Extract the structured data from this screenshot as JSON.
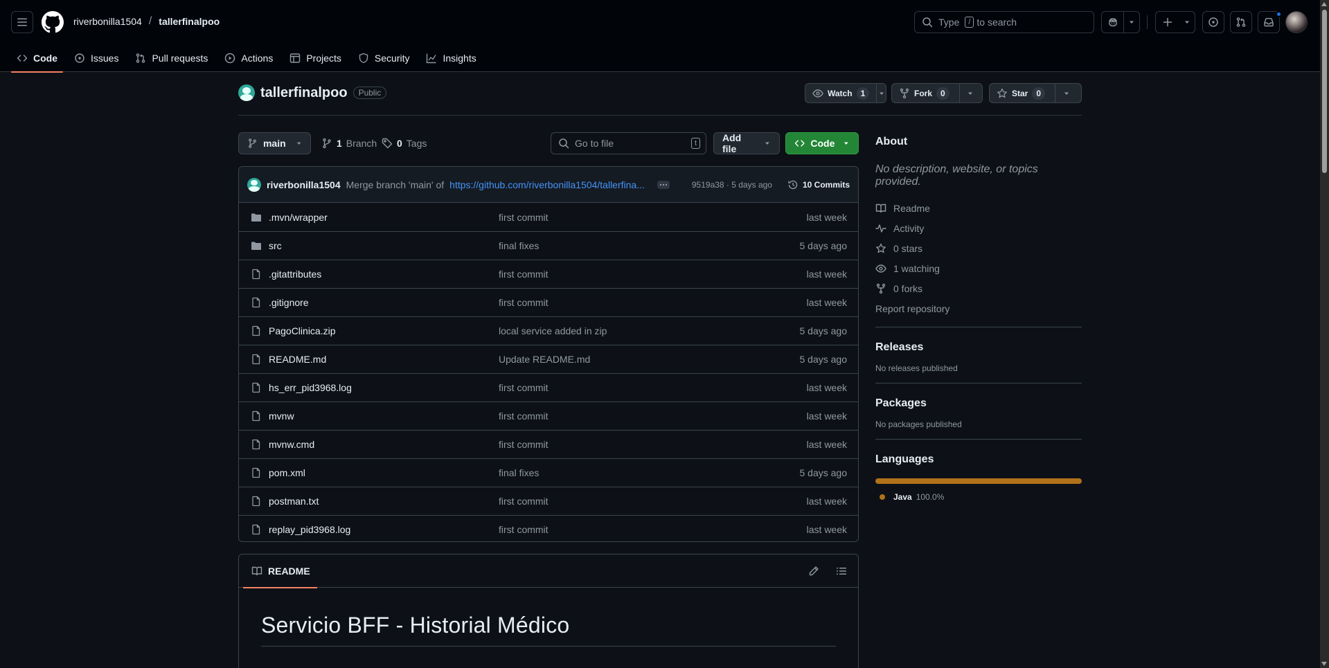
{
  "header": {
    "owner": "riverbonilla1504",
    "separator": "/",
    "repo": "tallerfinalpoo",
    "search_prefix": "Type",
    "search_key": "/",
    "search_suffix": "to search"
  },
  "repo_nav": {
    "tabs": [
      {
        "label": "Code",
        "icon": "code-icon",
        "active": true
      },
      {
        "label": "Issues",
        "icon": "issue-icon"
      },
      {
        "label": "Pull requests",
        "icon": "pull-request-icon"
      },
      {
        "label": "Actions",
        "icon": "play-icon"
      },
      {
        "label": "Projects",
        "icon": "table-icon"
      },
      {
        "label": "Security",
        "icon": "shield-icon"
      },
      {
        "label": "Insights",
        "icon": "graph-icon"
      }
    ]
  },
  "repo": {
    "name": "tallerfinalpoo",
    "visibility": "Public",
    "watch": {
      "label": "Watch",
      "count": "1"
    },
    "fork": {
      "label": "Fork",
      "count": "0"
    },
    "star": {
      "label": "Star",
      "count": "0"
    }
  },
  "branch_bar": {
    "branch": "main",
    "branches_count": "1",
    "branches_label": "Branch",
    "tags_count": "0",
    "tags_label": "Tags",
    "goto_placeholder": "Go to file",
    "goto_key": "t",
    "add_file": "Add file",
    "code_button": "Code"
  },
  "latest_commit": {
    "author": "riverbonilla1504",
    "message": "Merge branch 'main' of",
    "link": "https://github.com/riverbonilla1504/tallerfina...",
    "hash_time": "9519a38 · 5 days ago",
    "commits_count": "10 Commits"
  },
  "files": [
    {
      "name": ".mvn/wrapper",
      "type": "folder",
      "message": "first commit",
      "date": "last week"
    },
    {
      "name": "src",
      "type": "folder",
      "message": "final fixes",
      "date": "5 days ago"
    },
    {
      "name": ".gitattributes",
      "type": "file",
      "message": "first commit",
      "date": "last week"
    },
    {
      "name": ".gitignore",
      "type": "file",
      "message": "first commit",
      "date": "last week"
    },
    {
      "name": "PagoClinica.zip",
      "type": "file",
      "message": "local service added in zip",
      "date": "5 days ago"
    },
    {
      "name": "README.md",
      "type": "file",
      "message": "Update README.md",
      "date": "5 days ago"
    },
    {
      "name": "hs_err_pid3968.log",
      "type": "file",
      "message": "first commit",
      "date": "last week"
    },
    {
      "name": "mvnw",
      "type": "file",
      "message": "first commit",
      "date": "last week"
    },
    {
      "name": "mvnw.cmd",
      "type": "file",
      "message": "first commit",
      "date": "last week"
    },
    {
      "name": "pom.xml",
      "type": "file",
      "message": "final fixes",
      "date": "5 days ago"
    },
    {
      "name": "postman.txt",
      "type": "file",
      "message": "first commit",
      "date": "last week"
    },
    {
      "name": "replay_pid3968.log",
      "type": "file",
      "message": "first commit",
      "date": "last week"
    }
  ],
  "readme": {
    "tab": "README",
    "heading": "Servicio BFF - Historial Médico"
  },
  "about": {
    "title": "About",
    "description": "No description, website, or topics provided.",
    "links": [
      {
        "label": "Readme",
        "icon": "book-icon"
      },
      {
        "label": "Activity",
        "icon": "pulse-icon"
      },
      {
        "label": "0 stars",
        "icon": "star-icon"
      },
      {
        "label": "1 watching",
        "icon": "eye-icon"
      },
      {
        "label": "0 forks",
        "icon": "fork-icon"
      }
    ],
    "report": "Report repository"
  },
  "releases": {
    "title": "Releases",
    "text": "No releases published"
  },
  "packages": {
    "title": "Packages",
    "text": "No packages published"
  },
  "languages": {
    "title": "Languages",
    "items": [
      {
        "name": "Java",
        "percent": "100.0%",
        "color": "#b07219"
      }
    ]
  },
  "colors": {
    "background": "#0d1117",
    "header": "#010409",
    "accent_tab": "#f78166",
    "primary_button": "#238636",
    "link": "#4493f8"
  }
}
